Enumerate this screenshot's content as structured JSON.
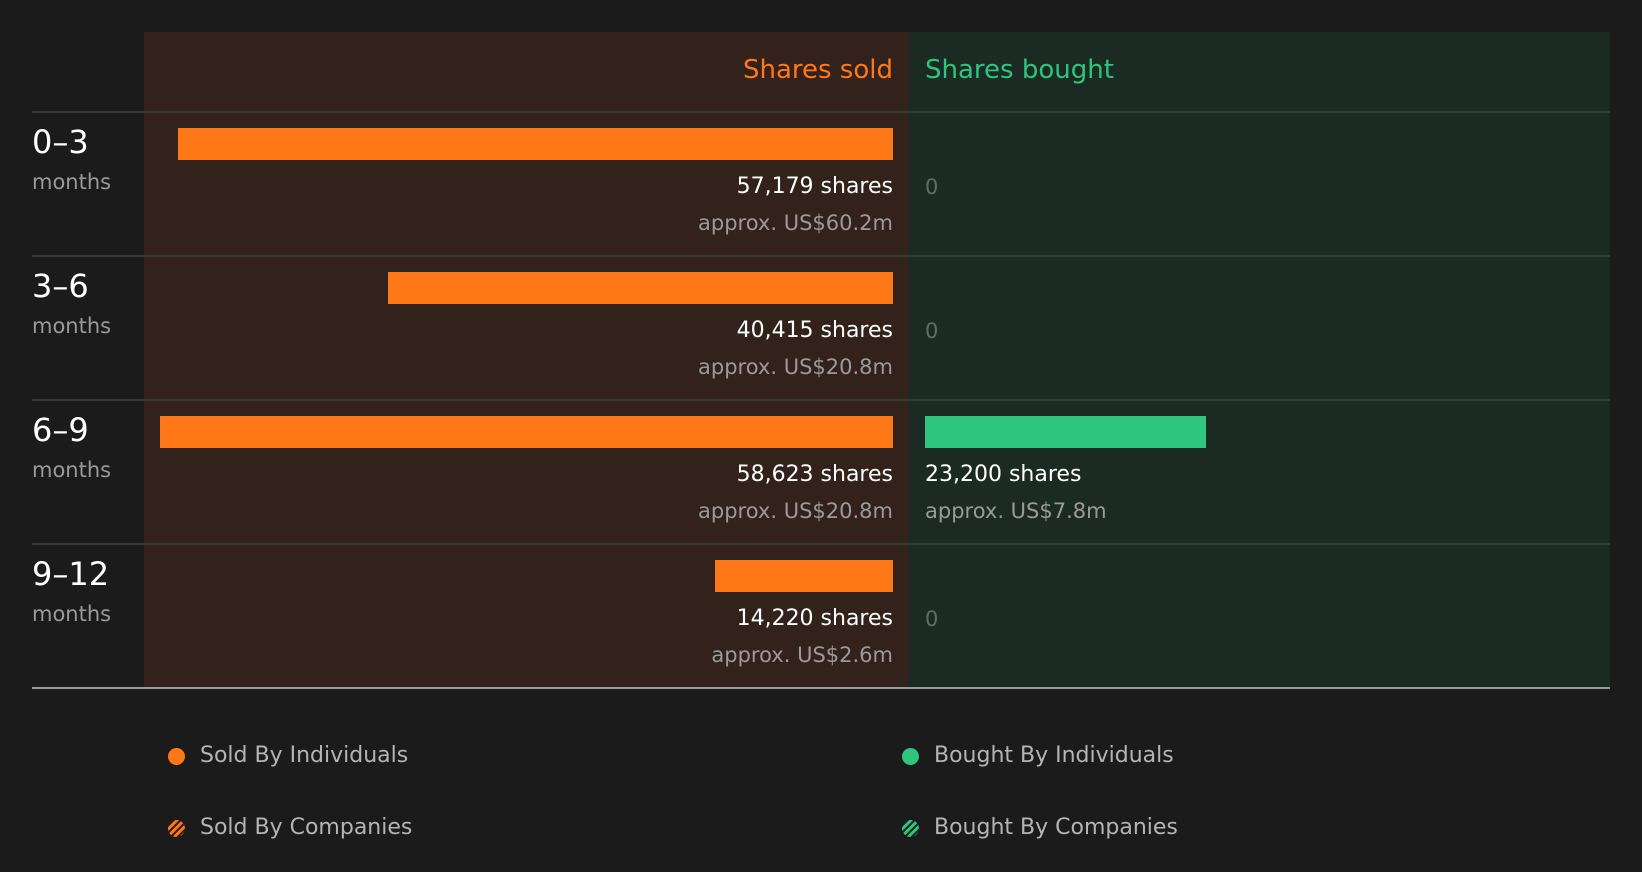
{
  "colors": {
    "sold": "#ff7817",
    "bought": "#2ec67c",
    "sold_band": "#32221b",
    "bought_band": "#1b2b24"
  },
  "headers": {
    "sold": "Shares sold",
    "bought": "Shares bought"
  },
  "legend": {
    "sold_individuals": "Sold By Individuals",
    "sold_companies": "Sold By Companies",
    "bought_individuals": "Bought By Individuals",
    "bought_companies": "Bought By Companies"
  },
  "chart_data": {
    "type": "bar",
    "orientation": "horizontal-diverging",
    "categories": [
      "0–3 months",
      "3–6 months",
      "6–9 months",
      "9–12 months"
    ],
    "rows": [
      {
        "period": "0–3",
        "unit": "months",
        "sold_shares": 57179,
        "sold_label": "57,179 shares",
        "sold_value": "approx. US$60.2m",
        "bought_shares": 0,
        "bought_label": "0",
        "bought_value": ""
      },
      {
        "period": "3–6",
        "unit": "months",
        "sold_shares": 40415,
        "sold_label": "40,415 shares",
        "sold_value": "approx. US$20.8m",
        "bought_shares": 0,
        "bought_label": "0",
        "bought_value": ""
      },
      {
        "period": "6–9",
        "unit": "months",
        "sold_shares": 58623,
        "sold_label": "58,623 shares",
        "sold_value": "approx. US$20.8m",
        "bought_shares": 23200,
        "bought_label": "23,200 shares",
        "bought_value": "approx. US$7.8m"
      },
      {
        "period": "9–12",
        "unit": "months",
        "sold_shares": 14220,
        "sold_label": "14,220 shares",
        "sold_value": "approx. US$2.6m",
        "bought_shares": 0,
        "bought_label": "0",
        "bought_value": ""
      }
    ],
    "series": [
      {
        "name": "Shares sold",
        "values": [
          57179,
          40415,
          58623,
          14220
        ]
      },
      {
        "name": "Shares bought",
        "values": [
          0,
          0,
          23200,
          0
        ]
      }
    ],
    "legend_position": "bottom"
  }
}
